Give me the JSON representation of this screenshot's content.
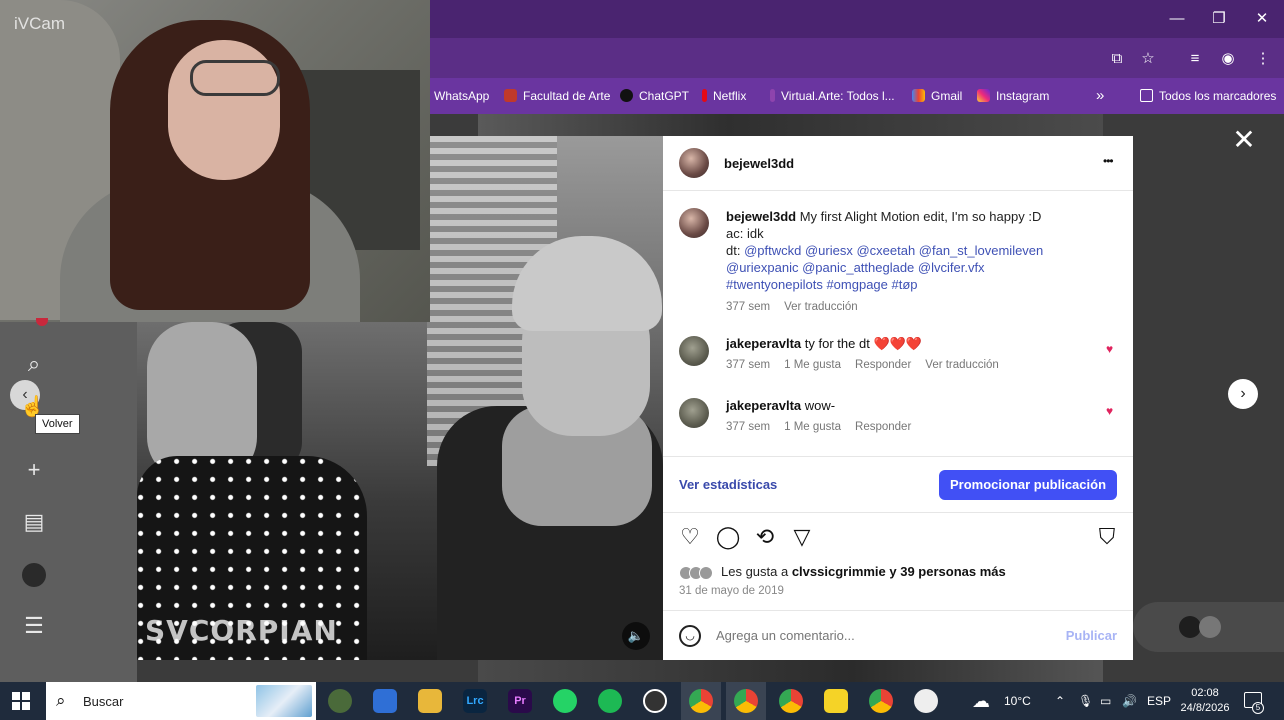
{
  "browser": {
    "window_controls": {
      "minimize": "—",
      "maximize": "❐",
      "close": "✕"
    },
    "bookmarks": [
      {
        "label": "WhatsApp",
        "color": "#25d366"
      },
      {
        "label": "Facultad de Arte",
        "color": "#c0392b"
      },
      {
        "label": "ChatGPT",
        "color": "#111111"
      },
      {
        "label": "Netflix",
        "color": "#e50914"
      },
      {
        "label": "Virtual.Arte: Todos l...",
        "color": "#8e44ad"
      },
      {
        "label": "Gmail",
        "color": "#ea4335"
      },
      {
        "label": "Instagram",
        "color": "#e1306c"
      }
    ],
    "bookmarks_overflow": "»",
    "all_bookmarks": "Todos los marcadores"
  },
  "webcam": {
    "label": "iVCam"
  },
  "left_nav": {
    "tooltip": "Volver"
  },
  "video": {
    "watermark": "SVCORPIAN",
    "mute_icon": "🔈"
  },
  "post": {
    "username": "bejewel3dd",
    "more": "•••",
    "caption": {
      "username": "bejewel3dd",
      "text_line1": "My first Alight Motion edit, I'm so happy :D",
      "text_line2": "ac: idk",
      "dt_prefix": "dt: ",
      "mentions_line1": "@pftwckd @uriesx @cxeetah @fan_st_lovemileven",
      "mentions_line2": "@uriexpanic @panic_attheglade @lvcifer.vfx",
      "hashtags": "#twentyonepilots #omgpage #tøp",
      "time": "377 sem",
      "translate": "Ver traducción"
    },
    "comments": [
      {
        "username": "jakeperavlta",
        "text": "ty for the dt ❤️❤️❤️",
        "time": "377 sem",
        "likes": "1 Me gusta",
        "reply": "Responder",
        "translate": "Ver traducción"
      },
      {
        "username": "jakeperavlta",
        "text": "wow-",
        "time": "377 sem",
        "likes": "1 Me gusta",
        "reply": "Responder",
        "translate": ""
      }
    ],
    "stats_link": "Ver estadísticas",
    "promote_button": "Promocionar publicación",
    "likes_prefix": "Les gusta a ",
    "likes_user": "clvssicgrimmie",
    "likes_suffix": " y 39 personas más",
    "date": "31 de mayo de 2019",
    "comment_placeholder": "Agrega un comentario...",
    "publish": "Publicar"
  },
  "overlay": {
    "close": "✕",
    "next": "›",
    "prev": "‹"
  },
  "taskbar": {
    "search_label": "Buscar",
    "weather": "10°C",
    "language": "ESP",
    "time": "02:08",
    "date": "24/8/2026",
    "notification_count": "5",
    "apps": [
      {
        "name": "lightroom",
        "label": "Lrc",
        "color": "#0a2540"
      },
      {
        "name": "premiere",
        "label": "Pr",
        "color": "#2a0a4a"
      },
      {
        "name": "whatsapp",
        "label": "",
        "color": "#25d366"
      },
      {
        "name": "spotify",
        "label": "",
        "color": "#1db954"
      }
    ]
  }
}
